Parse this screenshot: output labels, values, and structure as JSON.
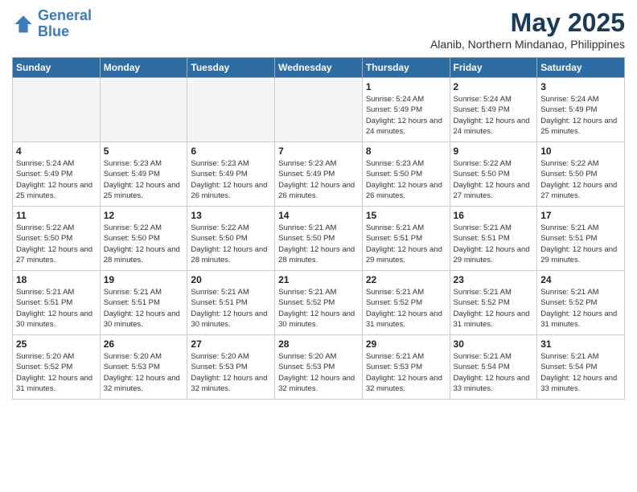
{
  "logo": {
    "line1": "General",
    "line2": "Blue"
  },
  "title": "May 2025",
  "subtitle": "Alanib, Northern Mindanao, Philippines",
  "weekdays": [
    "Sunday",
    "Monday",
    "Tuesday",
    "Wednesday",
    "Thursday",
    "Friday",
    "Saturday"
  ],
  "weeks": [
    [
      {
        "day": "",
        "sunrise": "",
        "sunset": "",
        "daylight": ""
      },
      {
        "day": "",
        "sunrise": "",
        "sunset": "",
        "daylight": ""
      },
      {
        "day": "",
        "sunrise": "",
        "sunset": "",
        "daylight": ""
      },
      {
        "day": "",
        "sunrise": "",
        "sunset": "",
        "daylight": ""
      },
      {
        "day": "1",
        "sunrise": "5:24 AM",
        "sunset": "5:49 PM",
        "daylight": "12 hours and 24 minutes."
      },
      {
        "day": "2",
        "sunrise": "5:24 AM",
        "sunset": "5:49 PM",
        "daylight": "12 hours and 24 minutes."
      },
      {
        "day": "3",
        "sunrise": "5:24 AM",
        "sunset": "5:49 PM",
        "daylight": "12 hours and 25 minutes."
      }
    ],
    [
      {
        "day": "4",
        "sunrise": "5:24 AM",
        "sunset": "5:49 PM",
        "daylight": "12 hours and 25 minutes."
      },
      {
        "day": "5",
        "sunrise": "5:23 AM",
        "sunset": "5:49 PM",
        "daylight": "12 hours and 25 minutes."
      },
      {
        "day": "6",
        "sunrise": "5:23 AM",
        "sunset": "5:49 PM",
        "daylight": "12 hours and 26 minutes."
      },
      {
        "day": "7",
        "sunrise": "5:23 AM",
        "sunset": "5:49 PM",
        "daylight": "12 hours and 26 minutes."
      },
      {
        "day": "8",
        "sunrise": "5:23 AM",
        "sunset": "5:50 PM",
        "daylight": "12 hours and 26 minutes."
      },
      {
        "day": "9",
        "sunrise": "5:22 AM",
        "sunset": "5:50 PM",
        "daylight": "12 hours and 27 minutes."
      },
      {
        "day": "10",
        "sunrise": "5:22 AM",
        "sunset": "5:50 PM",
        "daylight": "12 hours and 27 minutes."
      }
    ],
    [
      {
        "day": "11",
        "sunrise": "5:22 AM",
        "sunset": "5:50 PM",
        "daylight": "12 hours and 27 minutes."
      },
      {
        "day": "12",
        "sunrise": "5:22 AM",
        "sunset": "5:50 PM",
        "daylight": "12 hours and 28 minutes."
      },
      {
        "day": "13",
        "sunrise": "5:22 AM",
        "sunset": "5:50 PM",
        "daylight": "12 hours and 28 minutes."
      },
      {
        "day": "14",
        "sunrise": "5:21 AM",
        "sunset": "5:50 PM",
        "daylight": "12 hours and 28 minutes."
      },
      {
        "day": "15",
        "sunrise": "5:21 AM",
        "sunset": "5:51 PM",
        "daylight": "12 hours and 29 minutes."
      },
      {
        "day": "16",
        "sunrise": "5:21 AM",
        "sunset": "5:51 PM",
        "daylight": "12 hours and 29 minutes."
      },
      {
        "day": "17",
        "sunrise": "5:21 AM",
        "sunset": "5:51 PM",
        "daylight": "12 hours and 29 minutes."
      }
    ],
    [
      {
        "day": "18",
        "sunrise": "5:21 AM",
        "sunset": "5:51 PM",
        "daylight": "12 hours and 30 minutes."
      },
      {
        "day": "19",
        "sunrise": "5:21 AM",
        "sunset": "5:51 PM",
        "daylight": "12 hours and 30 minutes."
      },
      {
        "day": "20",
        "sunrise": "5:21 AM",
        "sunset": "5:51 PM",
        "daylight": "12 hours and 30 minutes."
      },
      {
        "day": "21",
        "sunrise": "5:21 AM",
        "sunset": "5:52 PM",
        "daylight": "12 hours and 30 minutes."
      },
      {
        "day": "22",
        "sunrise": "5:21 AM",
        "sunset": "5:52 PM",
        "daylight": "12 hours and 31 minutes."
      },
      {
        "day": "23",
        "sunrise": "5:21 AM",
        "sunset": "5:52 PM",
        "daylight": "12 hours and 31 minutes."
      },
      {
        "day": "24",
        "sunrise": "5:21 AM",
        "sunset": "5:52 PM",
        "daylight": "12 hours and 31 minutes."
      }
    ],
    [
      {
        "day": "25",
        "sunrise": "5:20 AM",
        "sunset": "5:52 PM",
        "daylight": "12 hours and 31 minutes."
      },
      {
        "day": "26",
        "sunrise": "5:20 AM",
        "sunset": "5:53 PM",
        "daylight": "12 hours and 32 minutes."
      },
      {
        "day": "27",
        "sunrise": "5:20 AM",
        "sunset": "5:53 PM",
        "daylight": "12 hours and 32 minutes."
      },
      {
        "day": "28",
        "sunrise": "5:20 AM",
        "sunset": "5:53 PM",
        "daylight": "12 hours and 32 minutes."
      },
      {
        "day": "29",
        "sunrise": "5:21 AM",
        "sunset": "5:53 PM",
        "daylight": "12 hours and 32 minutes."
      },
      {
        "day": "30",
        "sunrise": "5:21 AM",
        "sunset": "5:54 PM",
        "daylight": "12 hours and 33 minutes."
      },
      {
        "day": "31",
        "sunrise": "5:21 AM",
        "sunset": "5:54 PM",
        "daylight": "12 hours and 33 minutes."
      }
    ]
  ]
}
